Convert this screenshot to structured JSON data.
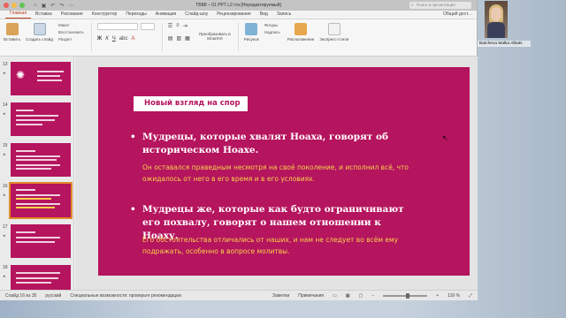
{
  "window": {
    "title": "ТВВ8 – 01 PPT L2 гпз [Нередактируемый]",
    "search_placeholder": "Поиск в презентации"
  },
  "tabs": [
    "Главная",
    "Вставка",
    "Рисование",
    "Конструктор",
    "Переходы",
    "Анимация",
    "Слайд-шоу",
    "Рецензирование",
    "Вид",
    "Запись"
  ],
  "share_label": "Общий дост...",
  "ribbon": {
    "paste": "Вставить",
    "create_slide": "Создать слайд",
    "layout": "Макет",
    "reset": "Восстановить",
    "section": "Раздел",
    "convert": "Преобразовать в SmartArt",
    "picture": "Рисунок",
    "shapes": "Фигуры",
    "textbox": "Надпись",
    "arrange": "Расположение",
    "quick_styles": "Экспресс-стили"
  },
  "sidebar": {
    "slides": [
      {
        "num": "13",
        "star": "★"
      },
      {
        "num": "14",
        "star": "★"
      },
      {
        "num": "15",
        "star": "★"
      },
      {
        "num": "16",
        "star": "★"
      },
      {
        "num": "17",
        "star": "★"
      },
      {
        "num": "18",
        "star": "★"
      }
    ]
  },
  "slide": {
    "header": "Новый взгляд на спор",
    "bullet1": "Мудрецы, которые хвалят Ноаха, говорят об историческом Ноахе.",
    "sub1": "Он оставался праведным несмотря на своё поколение, и исполнил всё, что ожидалось от него в его время и в его условиях.",
    "bullet2": "Мудрецы же, которые как будто ограничивают его похвалу, говорят о нашем отношении к Ноаху.",
    "sub2": "Его обстоятельства отличались от наших, и нам не следует во всём ему подражать, особенно в вопросе молитвы."
  },
  "status": {
    "slide_of": "Слайд 16 из 35",
    "language": "русский",
    "accessibility": "Специальные возможности: проверьте рекомендации",
    "notes": "Заметки",
    "comments": "Примечания",
    "zoom": "116 %"
  },
  "webcam": {
    "name": "Batcheva Malka Albats"
  },
  "colors": {
    "slide_bg": "#b5145e",
    "accent_yellow": "#f7d34a",
    "tab_active": "#b83b1a"
  }
}
